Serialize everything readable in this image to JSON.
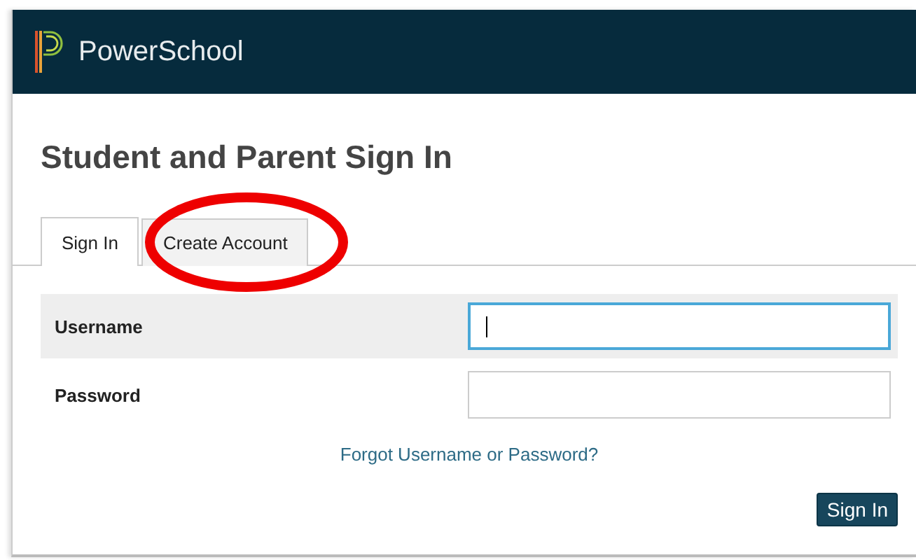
{
  "header": {
    "brand": "PowerSchool"
  },
  "title": "Student and Parent Sign In",
  "tabs": [
    {
      "label": "Sign In",
      "selected": true
    },
    {
      "label": "Create Account",
      "selected": false
    }
  ],
  "fields": [
    {
      "label": "Username",
      "focused": true
    },
    {
      "label": "Password",
      "focused": false
    }
  ],
  "forgot_link": "Forgot Username or Password?",
  "submit_button": "Sign In",
  "annotation": {
    "kind": "ellipse"
  }
}
